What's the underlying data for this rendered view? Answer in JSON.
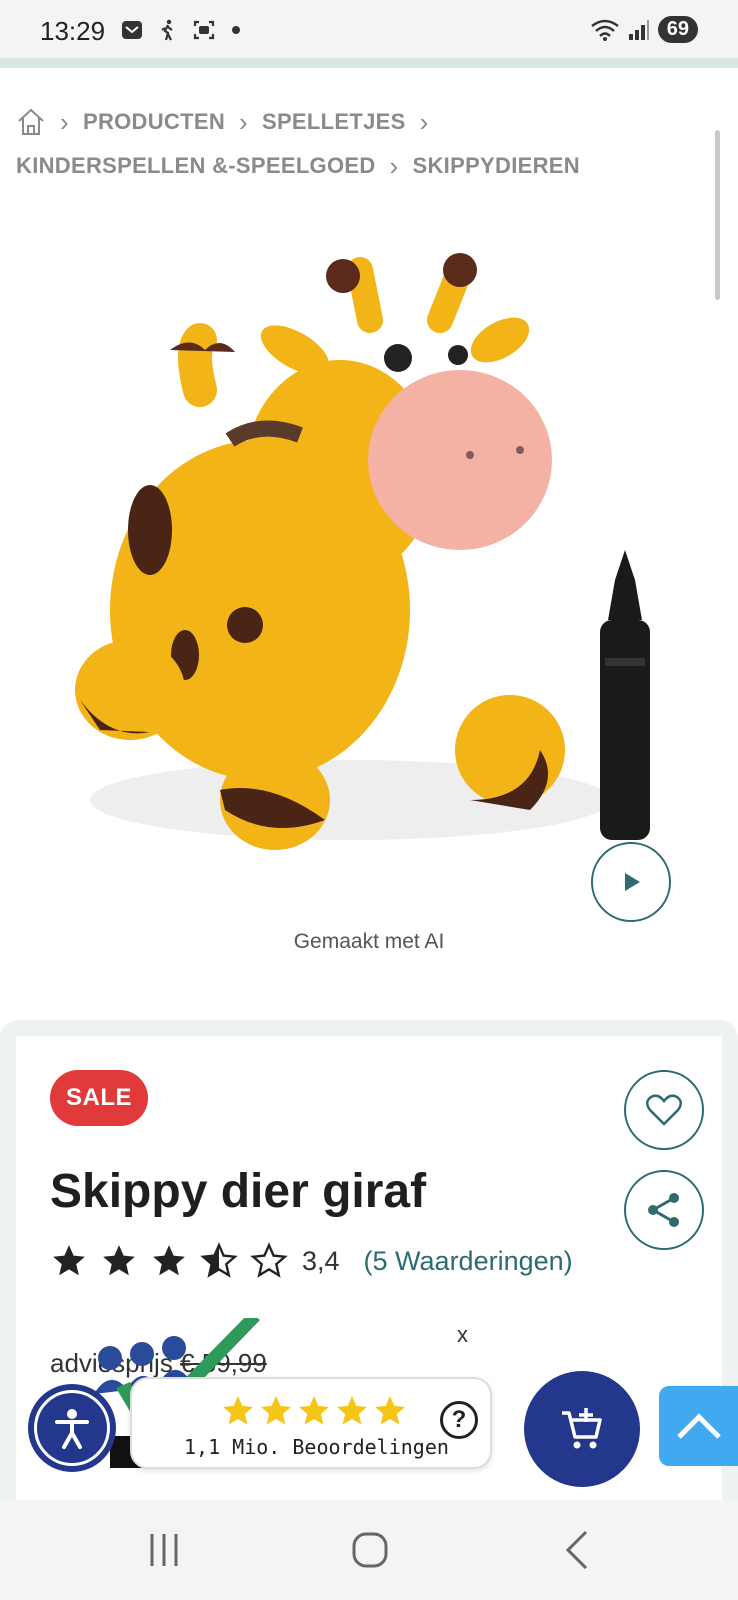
{
  "status_bar": {
    "time": "13:29",
    "battery": "69"
  },
  "breadcrumb": {
    "home_icon": "home-icon",
    "items": [
      "PRODUCTEN",
      "SPELLETJES",
      "KINDERSPELLEN &-SPEELGOED",
      "SKIPPYDIEREN"
    ]
  },
  "media": {
    "caption": "Gemaakt met AI",
    "play_icon": "play-icon"
  },
  "product": {
    "badge": "SALE",
    "title": "Skippy dier giraf",
    "rating": {
      "value_text": "3,4",
      "stars_filled": 3.5,
      "stars_max": 5,
      "reviews": "(5 Waarderingen)"
    },
    "advice_label": "adviesprijs",
    "advice_price": "€ 59,99",
    "close_label": "x"
  },
  "trust_badge": {
    "text": "1,1 Mio. Beoordelingen",
    "help": "?",
    "stars": 5
  },
  "colors": {
    "accent": "#2d6b70",
    "sale": "#e03a3a",
    "navy": "#23378c",
    "scroll_top": "#41a9f0",
    "star_yellow": "#f5c518"
  }
}
